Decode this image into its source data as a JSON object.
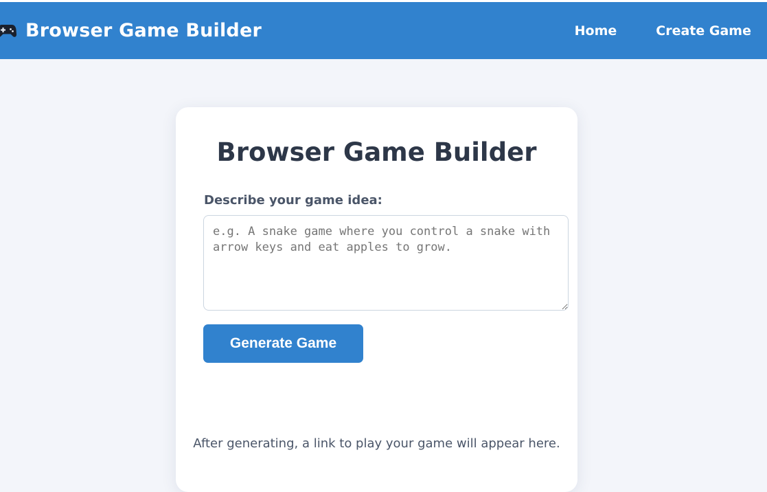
{
  "navbar": {
    "brand_icon": "gamepad-icon",
    "brand_title": "Browser Game Builder",
    "links": [
      {
        "label": "Home"
      },
      {
        "label": "Create Game"
      }
    ],
    "background_color": "#3182ce"
  },
  "main": {
    "title": "Browser Game Builder",
    "idea_field": {
      "label": "Describe your game idea:",
      "value": "",
      "placeholder": "e.g. A snake game where you control a snake with arrow keys and eat apples to grow."
    },
    "generate_label": "Generate Game",
    "result_hint": "After generating, a link to play your game will appear here."
  },
  "colors": {
    "accent": "#3182ce",
    "page_background": "#f3f5fa",
    "text_dark": "#2d3748",
    "text_muted": "#4a5568"
  }
}
